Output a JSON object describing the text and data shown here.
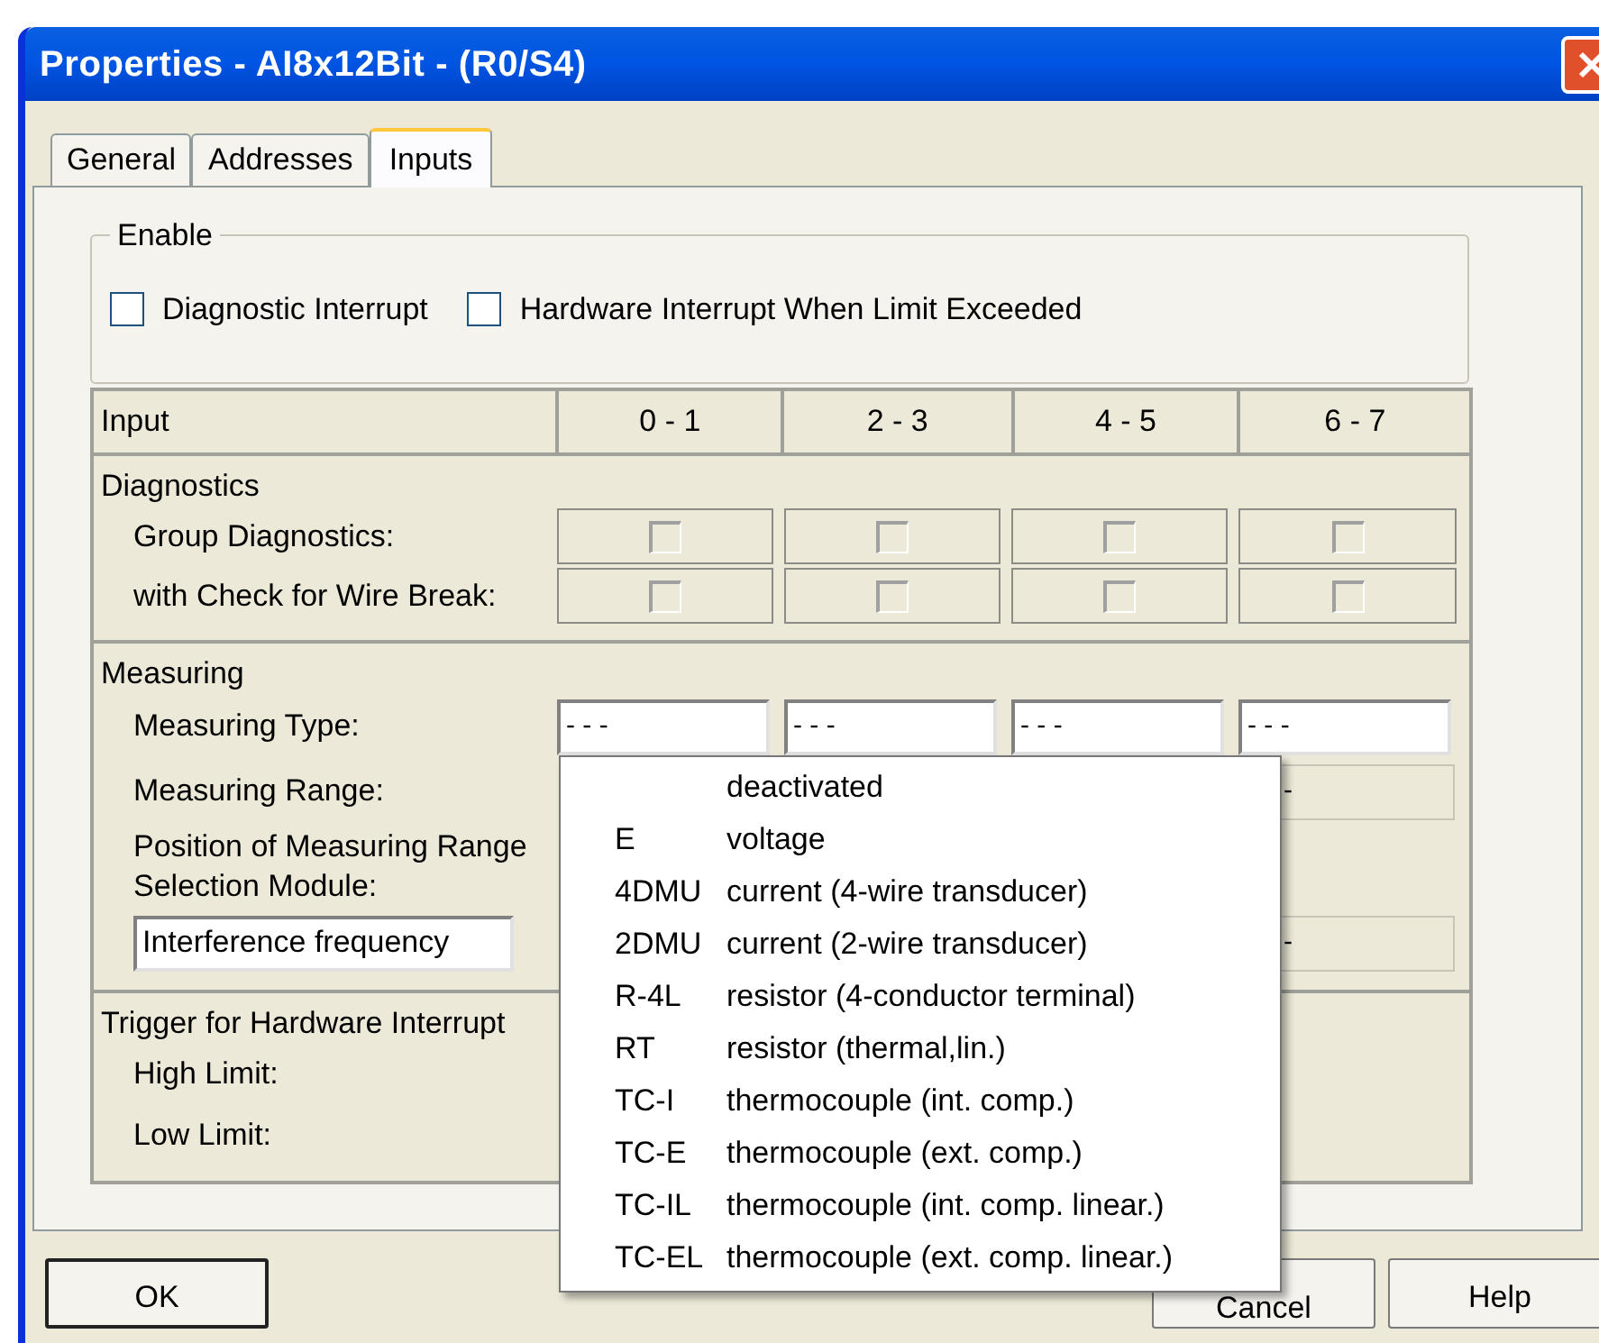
{
  "window": {
    "title": "Properties - AI8x12Bit - (R0/S4)"
  },
  "tabs": [
    {
      "label": "General",
      "selected": false
    },
    {
      "label": "Addresses",
      "selected": false
    },
    {
      "label": "Inputs",
      "selected": true
    }
  ],
  "enable": {
    "title": "Enable",
    "options": [
      {
        "label": "Diagnostic Interrupt",
        "checked": false
      },
      {
        "label": "Hardware Interrupt When Limit Exceeded",
        "checked": false
      }
    ]
  },
  "table": {
    "columns": [
      "Input",
      "0 - 1",
      "2 - 3",
      "4 - 5",
      "6 - 7"
    ],
    "sections": [
      {
        "title": "Diagnostics",
        "rows": [
          {
            "kind": "checks",
            "label": "Group Diagnostics:",
            "cells": [
              {
                "checked": false
              },
              {
                "checked": false
              },
              {
                "checked": false
              },
              {
                "checked": false
              }
            ]
          },
          {
            "kind": "checks",
            "label": "with Check for Wire Break:",
            "cells": [
              {
                "checked": false
              },
              {
                "checked": false
              },
              {
                "checked": false
              },
              {
                "checked": false
              }
            ]
          }
        ]
      },
      {
        "title": "Measuring",
        "rows": [
          {
            "kind": "select",
            "label": "Measuring Type:",
            "cells": [
              "- - -",
              "- - -",
              "- - -",
              "- - -"
            ]
          },
          {
            "kind": "readonly",
            "label": "Measuring Range:",
            "cells": [
              "-"
            ]
          },
          {
            "kind": "text",
            "label": "Position of Measuring Range Selection Module:"
          },
          {
            "kind": "readonly",
            "field_label": "Interference frequency",
            "cells": [
              "-"
            ]
          }
        ]
      },
      {
        "title": "Trigger for Hardware Interrupt",
        "rows": [
          {
            "kind": "text",
            "label": "High Limit:"
          },
          {
            "kind": "text",
            "label": "Low Limit:"
          }
        ]
      }
    ]
  },
  "dropdown": {
    "items": [
      {
        "label": "deactivated"
      },
      {
        "code": "E",
        "label": "voltage"
      },
      {
        "code": "4DMU",
        "label": "current (4-wire transducer)"
      },
      {
        "code": "2DMU",
        "label": "current (2-wire transducer)"
      },
      {
        "code": "R-4L",
        "label": "resistor (4-conductor terminal)"
      },
      {
        "code": "RT",
        "label": "resistor (thermal,lin.)"
      },
      {
        "code": "TC-I",
        "label": "thermocouple (int. comp.)"
      },
      {
        "code": "TC-E",
        "label": "thermocouple (ext. comp.)"
      },
      {
        "code": "TC-IL",
        "label": "thermocouple (int. comp. linear.)"
      },
      {
        "code": "TC-EL",
        "label": "thermocouple (ext. comp. linear.)"
      }
    ]
  },
  "buttons": [
    "OK",
    "Cancel",
    "Help"
  ]
}
